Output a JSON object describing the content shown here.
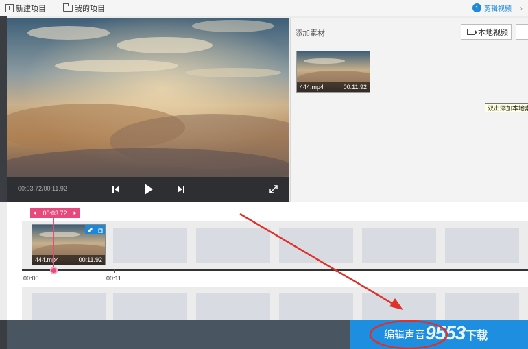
{
  "toolbar": {
    "new_project": "新建项目",
    "my_projects": "我的项目",
    "step_number": "1",
    "step_label": "剪辑视频"
  },
  "player": {
    "time_readout": "00:03.72/00:11.92"
  },
  "material": {
    "title": "添加素材",
    "local_video_button": "本地视频",
    "clip": {
      "name": "444.mp4",
      "duration": "00:11.92"
    },
    "tooltip": "双击添加本地素"
  },
  "timeline": {
    "playhead_time": "00:03.72",
    "clip": {
      "name": "444.mp4",
      "duration": "00:11.92"
    },
    "ruler_labels": [
      "00:00",
      "00:11"
    ]
  },
  "bottom": {
    "edit_audio_button": "编辑声音"
  },
  "watermark": {
    "number": "9553",
    "suffix": "下载"
  },
  "colors": {
    "accent": "#1e8ee0",
    "playhead": "#e8497c",
    "annotation": "#e0302a"
  }
}
